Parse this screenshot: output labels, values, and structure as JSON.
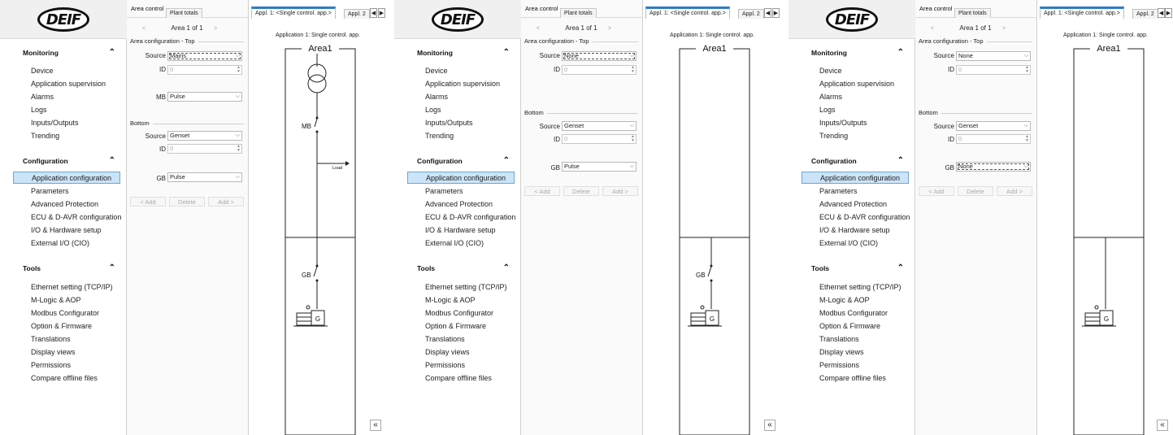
{
  "brand": {
    "logo_text": "DEIF"
  },
  "sidebar": {
    "monitoring": {
      "heading": "Monitoring",
      "items": [
        "Device",
        "Application supervision",
        "Alarms",
        "Logs",
        "Inputs/Outputs",
        "Trending"
      ]
    },
    "configuration": {
      "heading": "Configuration",
      "items": [
        "Application configuration",
        "Parameters",
        "Advanced Protection",
        "ECU & D-AVR configuration",
        "I/O & Hardware setup",
        "External I/O (CIO)"
      ]
    },
    "tools": {
      "heading": "Tools",
      "items": [
        "Ethernet setting (TCP/IP)",
        "M-Logic & AOP",
        "Modbus Configurator",
        "Option & Firmware",
        "Translations",
        "Display views",
        "Permissions",
        "Compare offline files"
      ]
    }
  },
  "config_panel": {
    "tab_area_control": "Area control",
    "tab_plant_totals": "Plant totals",
    "pager_prev": "<",
    "pager_next": ">",
    "pager_label": "Area 1 of 1",
    "group_top": "Area configuration - Top",
    "group_bottom": "Bottom",
    "source_label": "Source",
    "id_label": "ID",
    "mb_label": "MB",
    "gb_label": "GB",
    "id_value": "0",
    "add_left": "< Add",
    "delete": "Delete",
    "add_right": "Add >"
  },
  "panels": [
    {
      "top_source": "Mains",
      "mb": "Pulse",
      "bottom_source": "Genset",
      "gb": "Pulse"
    },
    {
      "top_source": "None",
      "bottom_source": "Genset",
      "gb": "Pulse"
    },
    {
      "top_source": "None",
      "bottom_source": "Genset",
      "gb": "None"
    }
  ],
  "diagram": {
    "tab_active": "Appl. 1: <Single control. app.>",
    "tab_other": "Appl. 2",
    "title": "Application 1: Single control. app.",
    "area_label": "Area1",
    "mb_label": "MB",
    "gb_label": "GB",
    "load_label": "Load",
    "gen_label": "G",
    "collapse": "«"
  }
}
